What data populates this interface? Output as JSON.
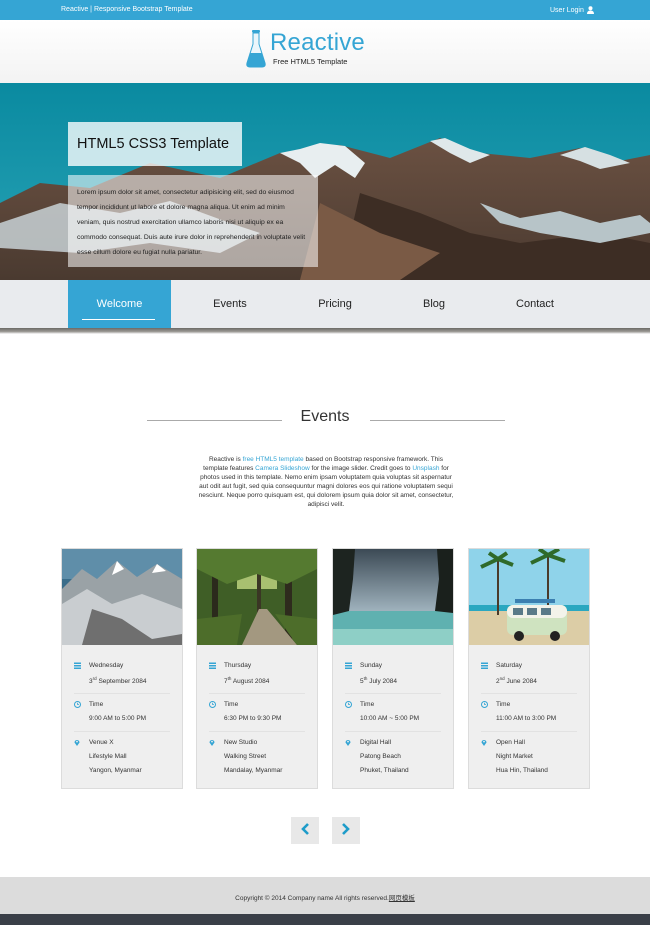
{
  "topbar": {
    "site_title": "Reactive | Responsive Bootstrap Template",
    "login_label": "User Login",
    "login_icon": "user-icon"
  },
  "brand": {
    "name": "Reactive",
    "tagline": "Free HTML5 Template",
    "logo_icon": "flask-icon",
    "color": "#35a5d4"
  },
  "hero": {
    "title": "HTML5 CSS3 Template",
    "text": "Lorem ipsum dolor sit amet, consectetur adipisicing elit, sed do eiusmod tempor incididunt ut labore et dolore magna aliqua. Ut enim ad minim veniam, quis nostrud exercitation ullamco laboris nisi ut aliquip ex ea commodo consequat. Duis aute irure dolor in reprehenderit in voluptate velit esse cillum dolore eu fugiat nulla pariatur."
  },
  "nav": {
    "active": "Welcome",
    "items": [
      "Welcome",
      "Events",
      "Pricing",
      "Blog",
      "Contact"
    ]
  },
  "events": {
    "heading": "Events",
    "desc_1": "Reactive is ",
    "desc_link_1": "free HTML5 template",
    "desc_2": " based on Bootstrap responsive framework. This template features ",
    "desc_link_2": "Camera Slideshow",
    "desc_3": " for the image slider. Credit goes to ",
    "desc_link_3": "Unsplash",
    "desc_4": " for photos used in this template. Nemo enim ipsam voluptatem quia voluptas sit aspernatur aut odit aut fugit, sed quia consequuntur magni dolores eos qui ratione voluptatem sequi nesciunt. Neque porro quisquam est, qui dolorem ipsum quia dolor sit amet, consectetur, adipisci velit.",
    "cards": [
      {
        "image": "snowy-mountain-photo",
        "day": "Wednesday",
        "date_num": "3",
        "date_sup": "rd",
        "date_rest": " September 2084",
        "time_label": "Time",
        "time": "9:00 AM to 5:00 PM",
        "venue": "Venue X",
        "place": "Lifestyle Mall",
        "city": "Yangon, Myanmar"
      },
      {
        "image": "forest-path-photo",
        "day": "Thursday",
        "date_num": "7",
        "date_sup": "th",
        "date_rest": " August 2084",
        "time_label": "Time",
        "time": "6:30 PM to 9:30 PM",
        "venue": "New Studio",
        "place": "Walking Street",
        "city": "Mandalay, Myanmar"
      },
      {
        "image": "sea-cliffs-photo",
        "day": "Sunday",
        "date_num": "5",
        "date_sup": "th",
        "date_rest": " July 2084",
        "time_label": "Time",
        "time": "10:00 AM ~ 5:00 PM",
        "venue": "Digital Hall",
        "place": "Patong Beach",
        "city": "Phuket, Thailand"
      },
      {
        "image": "beach-van-photo",
        "day": "Saturday",
        "date_num": "2",
        "date_sup": "nd",
        "date_rest": " June 2084",
        "time_label": "Time",
        "time": "11:00 AM to 3:00 PM",
        "venue": "Open Hall",
        "place": "Night Market",
        "city": "Hua Hin, Thailand"
      }
    ]
  },
  "pager": {
    "prev_icon": "chevron-left-icon",
    "next_icon": "chevron-right-icon"
  },
  "footer": {
    "copyright": "Copyright © 2014 Company name All rights reserved.",
    "link": "网页模板"
  }
}
